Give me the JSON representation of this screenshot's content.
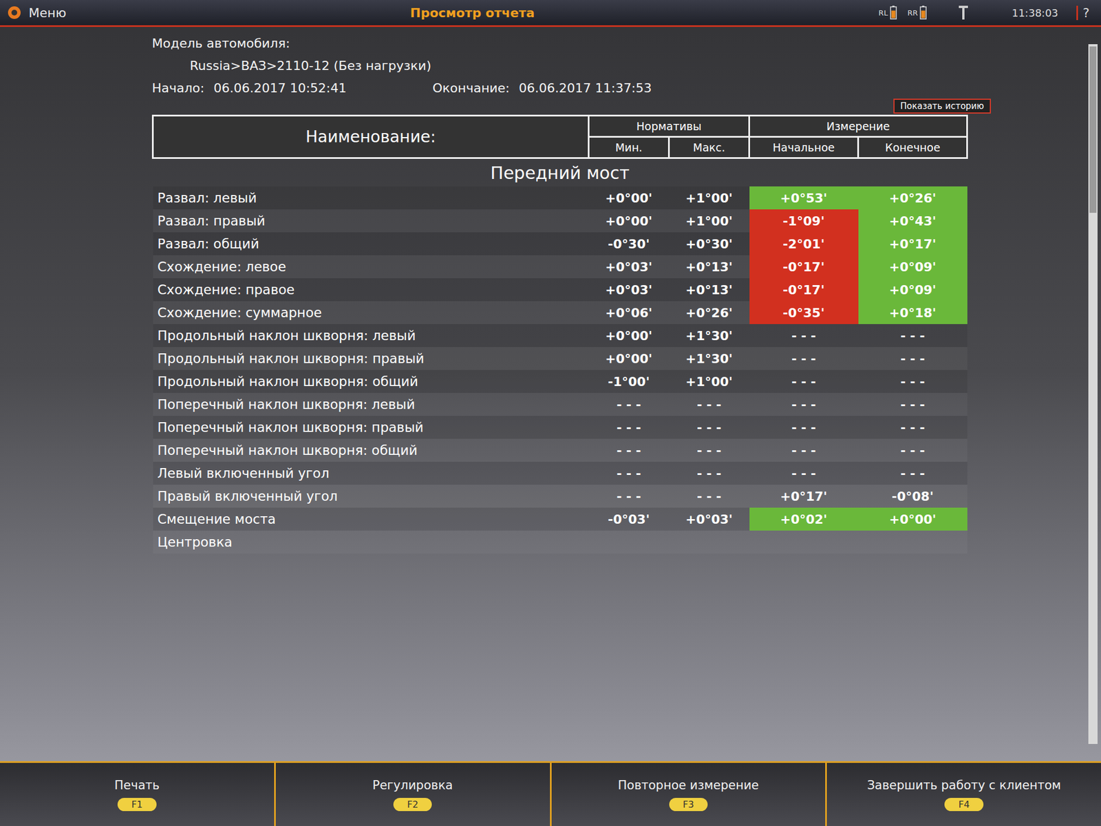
{
  "topbar": {
    "menu": "Меню",
    "title": "Просмотр отчета",
    "indicators": [
      {
        "label": "RL",
        "level": 0.7
      },
      {
        "label": "RR",
        "level": 0.7
      }
    ],
    "time": "11:38:03",
    "help": "?"
  },
  "info": {
    "model_label": "Модель автомобиля:",
    "model": "Russia>ВАЗ>2110-12 (Без нагрузки)",
    "start_label": "Начало:",
    "start": "06.06.2017 10:52:41",
    "end_label": "Окончание:",
    "end": "06.06.2017 11:37:53",
    "history_button": "Показать историю"
  },
  "table": {
    "columns": {
      "name": "Наименование:",
      "norms": "Нормативы",
      "min": "Мин.",
      "max": "Макс.",
      "measure": "Измерение",
      "initial": "Начальное",
      "final": "Конечное"
    },
    "section": "Передний мост",
    "rows": [
      {
        "name": "Развал: левый",
        "min": "+0°00'",
        "max": "+1°00'",
        "initial": "+0°53'",
        "initial_status": "ok",
        "final": "+0°26'",
        "final_status": "ok"
      },
      {
        "name": "Развал: правый",
        "min": "+0°00'",
        "max": "+1°00'",
        "initial": "-1°09'",
        "initial_status": "bad",
        "final": "+0°43'",
        "final_status": "ok"
      },
      {
        "name": "Развал: общий",
        "min": "-0°30'",
        "max": "+0°30'",
        "initial": "-2°01'",
        "initial_status": "bad",
        "final": "+0°17'",
        "final_status": "ok"
      },
      {
        "name": "Схождение: левое",
        "min": "+0°03'",
        "max": "+0°13'",
        "initial": "-0°17'",
        "initial_status": "bad",
        "final": "+0°09'",
        "final_status": "ok"
      },
      {
        "name": "Схождение: правое",
        "min": "+0°03'",
        "max": "+0°13'",
        "initial": "-0°17'",
        "initial_status": "bad",
        "final": "+0°09'",
        "final_status": "ok"
      },
      {
        "name": "Схождение: суммарное",
        "min": "+0°06'",
        "max": "+0°26'",
        "initial": "-0°35'",
        "initial_status": "bad",
        "final": "+0°18'",
        "final_status": "ok"
      },
      {
        "name": "Продольный наклон шкворня: левый",
        "min": "+0°00'",
        "max": "+1°30'",
        "initial": "- - -",
        "initial_status": "none",
        "final": "- - -",
        "final_status": "none"
      },
      {
        "name": "Продольный наклон шкворня: правый",
        "min": "+0°00'",
        "max": "+1°30'",
        "initial": "- - -",
        "initial_status": "none",
        "final": "- - -",
        "final_status": "none"
      },
      {
        "name": "Продольный наклон шкворня: общий",
        "min": "-1°00'",
        "max": "+1°00'",
        "initial": "- - -",
        "initial_status": "none",
        "final": "- - -",
        "final_status": "none"
      },
      {
        "name": "Поперечный наклон шкворня: левый",
        "min": "- - -",
        "max": "- - -",
        "initial": "- - -",
        "initial_status": "none",
        "final": "- - -",
        "final_status": "none"
      },
      {
        "name": "Поперечный наклон шкворня: правый",
        "min": "- - -",
        "max": "- - -",
        "initial": "- - -",
        "initial_status": "none",
        "final": "- - -",
        "final_status": "none"
      },
      {
        "name": "Поперечный наклон шкворня: общий",
        "min": "- - -",
        "max": "- - -",
        "initial": "- - -",
        "initial_status": "none",
        "final": "- - -",
        "final_status": "none"
      },
      {
        "name": "Левый включенный угол",
        "min": "- - -",
        "max": "- - -",
        "initial": "- - -",
        "initial_status": "none",
        "final": "- - -",
        "final_status": "none"
      },
      {
        "name": "Правый включенный угол",
        "min": "- - -",
        "max": "- - -",
        "initial": "+0°17'",
        "initial_status": "none",
        "final": "-0°08'",
        "final_status": "none"
      },
      {
        "name": "Смещение моста",
        "min": "-0°03'",
        "max": "+0°03'",
        "initial": "+0°02'",
        "initial_status": "ok",
        "final": "+0°00'",
        "final_status": "ok"
      },
      {
        "name": "Центровка",
        "min": "",
        "max": "",
        "initial": "",
        "initial_status": "none",
        "final": "",
        "final_status": "none"
      }
    ]
  },
  "footer": [
    {
      "label": "Печать",
      "key": "F1"
    },
    {
      "label": "Регулировка",
      "key": "F2"
    },
    {
      "label": "Повторное измерение",
      "key": "F3"
    },
    {
      "label": "Завершить работу с клиентом",
      "key": "F4"
    }
  ]
}
